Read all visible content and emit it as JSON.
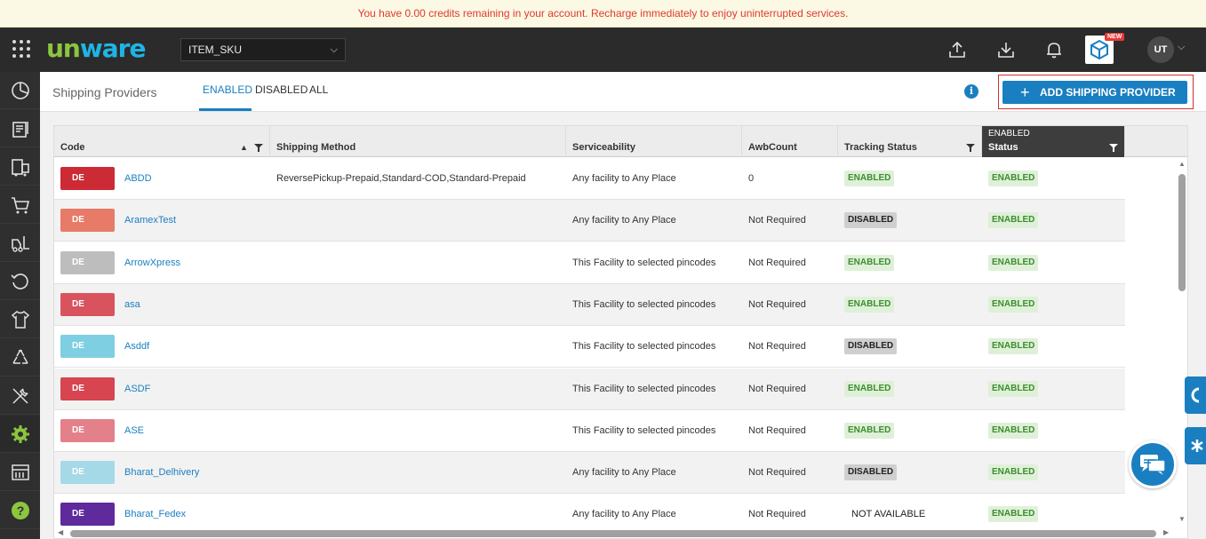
{
  "banner": {
    "text": "You have 0.00 credits remaining in your account. Recharge immediately to enjoy uninterrupted services."
  },
  "topbar": {
    "logo": {
      "u": "un",
      "rest": "ware",
      "colors": {
        "u": "#8cc63f",
        "rest": "#1fb4e4"
      }
    },
    "facility": {
      "value": "ITEM_SKU"
    },
    "new_badge": "NEW",
    "avatar": "UT",
    "icons": [
      "apps-grid-icon",
      "upload-icon",
      "download-icon",
      "bell-icon",
      "app-store-icon",
      "chevron-down-icon"
    ]
  },
  "sidebar": {
    "items": [
      "dashboard-icon",
      "orders-icon",
      "shipping-icon",
      "cart-icon",
      "forklift-icon",
      "returns-icon",
      "apparel-icon",
      "recycle-icon",
      "tools-icon",
      "settings-icon",
      "reports-icon",
      "help-icon"
    ],
    "active": "settings-icon"
  },
  "subheader": {
    "title": "Shipping Providers",
    "tabs": [
      {
        "label": "ENABLED",
        "active": true
      },
      {
        "label": "DISABLED",
        "active": false
      },
      {
        "label": "ALL",
        "active": false
      }
    ],
    "info_icon": "i",
    "add_button": "ADD SHIPPING PROVIDER"
  },
  "table": {
    "columns": {
      "code": "Code",
      "method": "Shipping Method",
      "serviceability": "Serviceability",
      "awb": "AwbCount",
      "tracking": "Tracking Status",
      "status_filter": "ENABLED",
      "status": "Status"
    },
    "rows": [
      {
        "chip": "DE",
        "chip_color": "#cc2a35",
        "code": "ABDD",
        "method": "ReversePickup-Prepaid,Standard-COD,Standard-Prepaid",
        "serviceability": "Any facility to Any Place",
        "awb": "0",
        "tracking": "ENABLED",
        "tracking_type": "en",
        "status": "ENABLED"
      },
      {
        "chip": "DE",
        "chip_color": "#e87a68",
        "code": "AramexTest",
        "method": "",
        "serviceability": "Any facility to Any Place",
        "awb": "Not Required",
        "tracking": "DISABLED",
        "tracking_type": "dis",
        "status": "ENABLED"
      },
      {
        "chip": "DE",
        "chip_color": "#bdbdbd",
        "code": "ArrowXpress",
        "method": "",
        "serviceability": "This Facility to selected pincodes",
        "awb": "Not Required",
        "tracking": "ENABLED",
        "tracking_type": "en",
        "status": "ENABLED"
      },
      {
        "chip": "DE",
        "chip_color": "#d9535f",
        "code": "asa",
        "method": "",
        "serviceability": "This Facility to selected pincodes",
        "awb": "Not Required",
        "tracking": "ENABLED",
        "tracking_type": "en",
        "status": "ENABLED"
      },
      {
        "chip": "DE",
        "chip_color": "#7fcfe3",
        "code": "Asddf",
        "method": "",
        "serviceability": "This Facility to selected pincodes",
        "awb": "Not Required",
        "tracking": "DISABLED",
        "tracking_type": "dis",
        "status": "ENABLED"
      },
      {
        "chip": "DE",
        "chip_color": "#d64550",
        "code": "ASDF",
        "method": "",
        "serviceability": "This Facility to selected pincodes",
        "awb": "Not Required",
        "tracking": "ENABLED",
        "tracking_type": "en",
        "status": "ENABLED"
      },
      {
        "chip": "DE",
        "chip_color": "#e3808a",
        "code": "ASE",
        "method": "",
        "serviceability": "This Facility to selected pincodes",
        "awb": "Not Required",
        "tracking": "ENABLED",
        "tracking_type": "en",
        "status": "ENABLED"
      },
      {
        "chip": "DE",
        "chip_color": "#a6d9e8",
        "code": "Bharat_Delhivery",
        "method": "",
        "serviceability": "Any facility to Any Place",
        "awb": "Not Required",
        "tracking": "DISABLED",
        "tracking_type": "dis",
        "status": "ENABLED"
      },
      {
        "chip": "DE",
        "chip_color": "#5e2a9c",
        "code": "Bharat_Fedex",
        "method": "",
        "serviceability": "Any facility to Any Place",
        "awb": "Not Required",
        "tracking": "NOT AVAILABLE",
        "tracking_type": "na",
        "status": "ENABLED"
      }
    ]
  }
}
